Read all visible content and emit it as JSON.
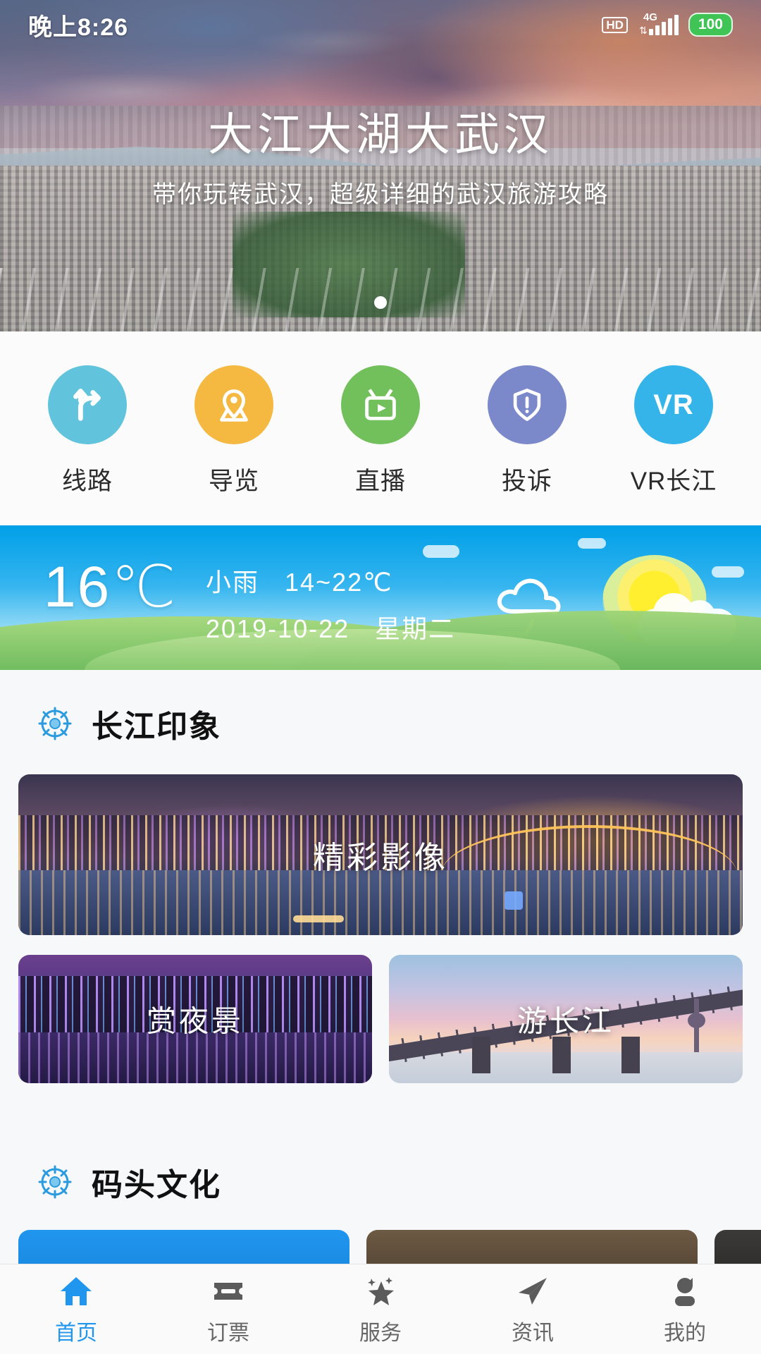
{
  "statusbar": {
    "time": "晚上8:26",
    "hd": "HD",
    "network": "4G",
    "battery": "100"
  },
  "hero": {
    "title": "大江大湖大武汉",
    "subtitle": "带你玩转武汉，超级详细的武汉旅游攻略",
    "dots": 1,
    "active_dot": 0
  },
  "quick_actions": [
    {
      "label": "线路",
      "icon": "route-icon",
      "color": "#62c3dd"
    },
    {
      "label": "导览",
      "icon": "map-pin-icon",
      "color": "#f5b841"
    },
    {
      "label": "直播",
      "icon": "tv-live-icon",
      "color": "#72c05c"
    },
    {
      "label": "投诉",
      "icon": "shield-alert-icon",
      "color": "#7b89cb"
    },
    {
      "label": "VR长江",
      "icon": "vr-icon",
      "color": "#35b4ea",
      "badge": "VR"
    }
  ],
  "weather": {
    "temperature": "16℃",
    "condition": "小雨",
    "range": "14~22℃",
    "date": "2019-10-22",
    "weekday": "星期二",
    "icon": "rain-cloud-icon",
    "secondary_icon": "sun-cloud-icon"
  },
  "sections": [
    {
      "title": "长江印象",
      "icon": "ship-helm-icon",
      "feature_card": {
        "label": "精彩影像",
        "image": "wuhan-night-river-panorama"
      },
      "cards": [
        {
          "label": "赏夜景",
          "image": "purple-night-skyline"
        },
        {
          "label": "游长江",
          "image": "yangtze-bridge-dusk"
        }
      ]
    },
    {
      "title": "码头文化",
      "icon": "ship-helm-icon",
      "cards": [
        {
          "label": "",
          "image": "blue-card"
        },
        {
          "label": "",
          "image": "dark-card"
        },
        {
          "label": "",
          "image": "cut-off-card"
        }
      ]
    }
  ],
  "tabbar": {
    "items": [
      {
        "label": "首页",
        "icon": "home-icon",
        "active": true
      },
      {
        "label": "订票",
        "icon": "ticket-icon",
        "active": false
      },
      {
        "label": "服务",
        "icon": "star-icon",
        "active": false
      },
      {
        "label": "资讯",
        "icon": "paper-plane-icon",
        "active": false
      },
      {
        "label": "我的",
        "icon": "person-icon",
        "active": false
      }
    ],
    "active_color": "#2196ef",
    "inactive_color": "#666666"
  }
}
